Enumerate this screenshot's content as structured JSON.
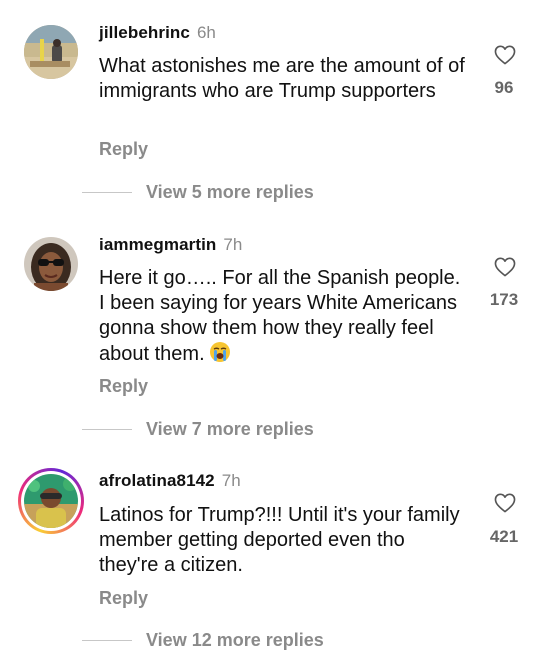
{
  "comments": [
    {
      "username": "jillebehrinc",
      "time": "6h",
      "text": "What astonishes me are the amount of of immigrants who are Trump supporters",
      "reply_label": "Reply",
      "likes": "96",
      "view_more": "View 5 more replies",
      "avatar_icon": "beach-photo-avatar"
    },
    {
      "username": "iammegmartin",
      "time": "7h",
      "text": "Here it go….. For all the Spanish people. I been saying for years White Americans gonna show them how they really feel about them.",
      "emoji": "loudly-crying-face-icon",
      "reply_label": "Reply",
      "likes": "173",
      "view_more": "View 7 more replies",
      "avatar_icon": "woman-sunglasses-avatar"
    },
    {
      "username": "afrolatina8142",
      "time": "7h",
      "text": "Latinos for Trump?!!! Until it's your family member getting deported even tho they're a citizen.",
      "reply_label": "Reply",
      "likes": "421",
      "view_more": "View 12 more replies",
      "avatar_icon": "story-ring-avatar"
    }
  ],
  "colors": {
    "secondary_text": "#8a8a8a",
    "divider": "#c7c7c7",
    "story_ring_start": "#f9ce34",
    "story_ring_mid": "#ee2a7b",
    "story_ring_end": "#6228d7"
  }
}
